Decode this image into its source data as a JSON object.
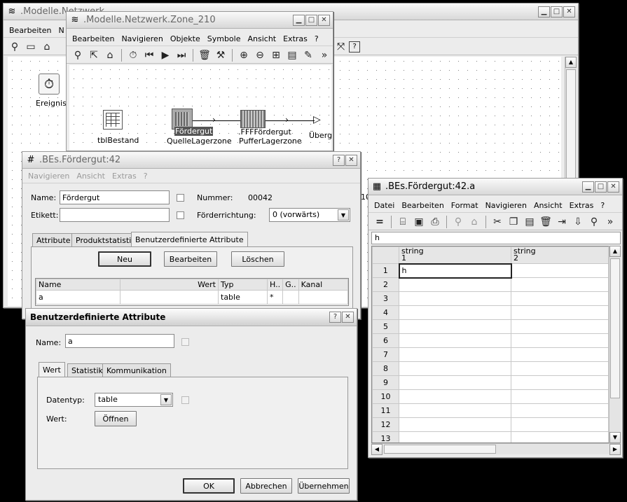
{
  "win_models": {
    "title": ".Modelle.Netzwerk",
    "menu": [
      "Bearbeiten",
      "N"
    ],
    "canvas_item_label": "Ereignisv",
    "partial_number": "10"
  },
  "win_zone": {
    "title": ".Modelle.Netzwerk.Zone_210",
    "menu": [
      "Bearbeiten",
      "Navigieren",
      "Objekte",
      "Symbole",
      "Ansicht",
      "Extras",
      "?"
    ],
    "more": "»",
    "nodes": {
      "tbl": "tblBestand",
      "quelle_top": "Fördergut",
      "quelle_bottom": "QuelleLagerzone",
      "puffer_top": ".FFFFördergut",
      "puffer_bottom": "PufferLagerzone",
      "uebergabe": "Überg"
    }
  },
  "win_bes": {
    "title": ".BEs.Fördergut:42",
    "menu": [
      "Navigieren",
      "Ansicht",
      "Extras",
      "?"
    ],
    "name_label": "Name:",
    "name_value": "Fördergut",
    "etikett_label": "Etikett:",
    "etikett_value": "",
    "nummer_label": "Nummer:",
    "nummer_value": "00042",
    "richtung_label": "Förderrichtung:",
    "richtung_value": "0 (vorwärts)",
    "tabs": [
      "Attribute",
      "Produktstatistik",
      "Benutzerdefinierte Attribute"
    ],
    "btn_neu": "Neu",
    "btn_bearbeiten": "Bearbeiten",
    "btn_loeschen": "Löschen",
    "columns": [
      "Name",
      "Wert",
      "Typ",
      "H..",
      "G..",
      "Kanal"
    ],
    "rows": [
      {
        "name": "a",
        "wert": "",
        "typ": "table",
        "h": "*",
        "g": "",
        "kanal": ""
      }
    ]
  },
  "win_dlg": {
    "title": "Benutzerdefinierte Attribute",
    "name_label": "Name:",
    "name_value": "a",
    "tabs": [
      "Wert",
      "Statistik",
      "Kommunikation"
    ],
    "datentyp_label": "Datentyp:",
    "datentyp_value": "table",
    "wert_label": "Wert:",
    "btn_oeffnen": "Öffnen",
    "btn_ok": "OK",
    "btn_abbrechen": "Abbrechen",
    "btn_uebernehmen": "Übernehmen"
  },
  "win_table": {
    "title": ".BEs.Fördergut:42.a",
    "menu": [
      "Datei",
      "Bearbeiten",
      "Format",
      "Navigieren",
      "Ansicht",
      "Extras",
      "?"
    ],
    "more": "»",
    "formula": "h",
    "col_types": [
      "string",
      "string"
    ],
    "col_nums": [
      "1",
      "2"
    ],
    "rows": [
      {
        "n": "1",
        "a": "h",
        "b": ""
      },
      {
        "n": "2",
        "a": "",
        "b": ""
      },
      {
        "n": "3",
        "a": "",
        "b": ""
      },
      {
        "n": "4",
        "a": "",
        "b": ""
      },
      {
        "n": "5",
        "a": "",
        "b": ""
      },
      {
        "n": "6",
        "a": "",
        "b": ""
      },
      {
        "n": "7",
        "a": "",
        "b": ""
      },
      {
        "n": "8",
        "a": "",
        "b": ""
      },
      {
        "n": "9",
        "a": "",
        "b": ""
      },
      {
        "n": "10",
        "a": "",
        "b": ""
      },
      {
        "n": "11",
        "a": "",
        "b": ""
      },
      {
        "n": "12",
        "a": "",
        "b": ""
      },
      {
        "n": "13",
        "a": "",
        "b": ""
      }
    ]
  }
}
